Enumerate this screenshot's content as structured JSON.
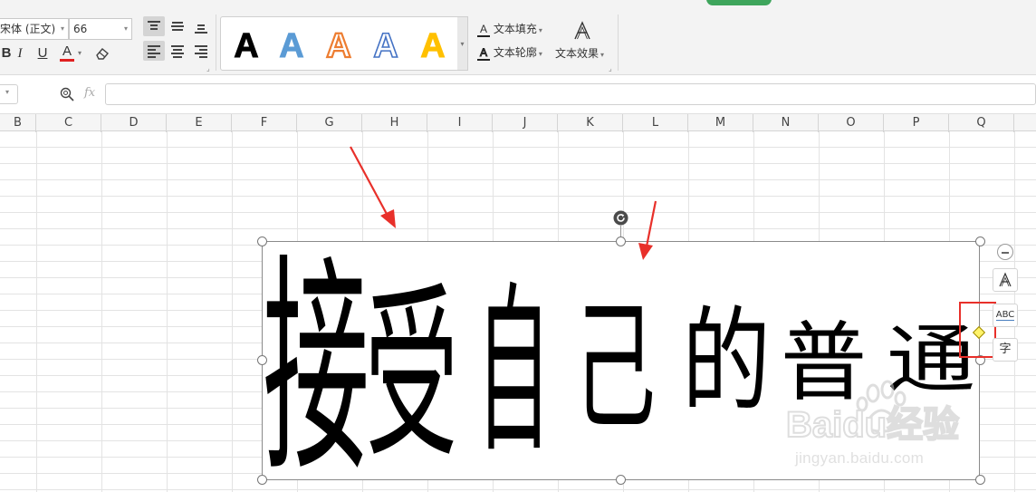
{
  "ribbon": {
    "font_name": "宋体 (正文)",
    "font_size": "66",
    "bold": "B",
    "italic": "I",
    "underline": "U",
    "font_color": "A",
    "text_fill": "文本填充",
    "text_outline": "文本轮廓",
    "text_effects": "文本效果",
    "style_presets": [
      {
        "glyph": "A",
        "fill": "#000000",
        "stroke": "#000000"
      },
      {
        "glyph": "A",
        "fill": "#5b9bd5",
        "stroke": "#5b9bd5"
      },
      {
        "glyph": "A",
        "fill": "#ffffff",
        "stroke": "#ed7d31"
      },
      {
        "glyph": "A",
        "fill": "#ffffff",
        "stroke": "#4472c4"
      },
      {
        "glyph": "A",
        "fill": "#ffc000",
        "stroke": "#ffc000"
      }
    ]
  },
  "formula_bar": {
    "fx_label": "fx",
    "value": ""
  },
  "columns": [
    "B",
    "C",
    "D",
    "E",
    "F",
    "G",
    "H",
    "I",
    "J",
    "K",
    "L",
    "M",
    "N",
    "O",
    "P",
    "Q"
  ],
  "wordart": {
    "chars": [
      "接",
      "受",
      "自",
      "己",
      "的",
      "普",
      "通"
    ],
    "color": "#000000"
  },
  "side_tools": {
    "abc_label": "ABC",
    "char_label": "字"
  },
  "watermark": {
    "brand": "Baidu经验",
    "url": "jingyan.baidu.com"
  },
  "colors": {
    "accent_green": "#3ea55c",
    "annotation_red": "#e8302a",
    "handle_yellow": "#fff36a"
  }
}
